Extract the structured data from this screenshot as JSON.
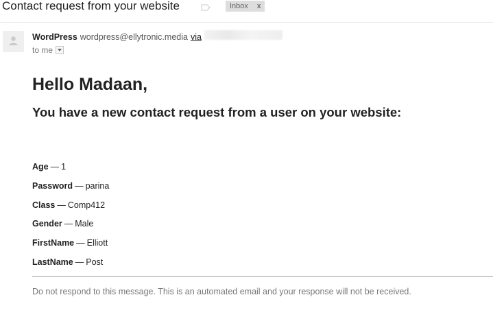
{
  "header": {
    "subject": "Contact request from your website",
    "label_icon": "label-outline-icon",
    "label_chip": {
      "text": "Inbox",
      "remove": "x"
    }
  },
  "sender": {
    "avatar_icon": "person-silhouette-icon",
    "name": "WordPress",
    "email": "wordpress@ellytronic.media",
    "via_label": "via"
  },
  "recipient": {
    "to_label": "to me",
    "dropdown_icon": "caret-down-icon"
  },
  "body": {
    "greeting": "Hello Madaan,",
    "intro": "You have a new contact request from a user on your website:",
    "separator": "—",
    "fields": [
      {
        "key": "Age",
        "value": "1"
      },
      {
        "key": "Password",
        "value": "parina"
      },
      {
        "key": "Class",
        "value": "Comp412"
      },
      {
        "key": "Gender",
        "value": "Male"
      },
      {
        "key": "FirstName",
        "value": "Elliott"
      },
      {
        "key": "LastName",
        "value": "Post"
      }
    ],
    "footer": "Do not respond to this message. This is an automated email and your response will not be received."
  },
  "colors": {
    "text": "#222222",
    "muted": "#777777",
    "chip_bg": "#dddddd",
    "divider": "#9e9e9e"
  }
}
